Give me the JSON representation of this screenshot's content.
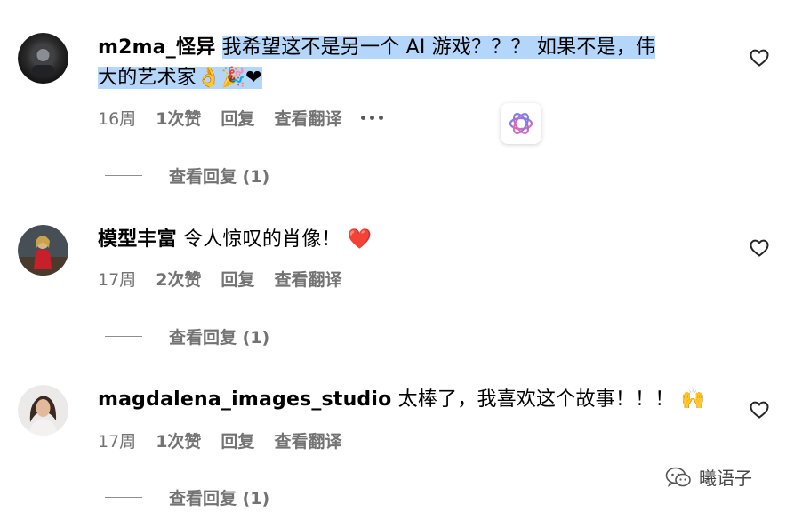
{
  "comments": [
    {
      "username": "m2ma_怪异",
      "text_line1": "我希望这不是另一个 AI 游戏？？？ 如果不是，伟",
      "text_line2": "大的艺术家👌🎉❤",
      "time": "16周",
      "likes": "1次赞",
      "reply": "回复",
      "translate": "查看翻译",
      "view_replies": "查看回复 (1)"
    },
    {
      "username": "模型丰富",
      "text_line1": "令人惊叹的肖像！ ❤️",
      "time": "17周",
      "likes": "2次赞",
      "reply": "回复",
      "translate": "查看翻译",
      "view_replies": "查看回复 (1)"
    },
    {
      "username": "magdalena_images_studio",
      "text_line1": "太棒了，我喜欢这个故事！！！ 🙌",
      "time": "17周",
      "likes": "1次赞",
      "reply": "回复",
      "translate": "查看翻译",
      "view_replies": "查看回复 (1)"
    }
  ],
  "icons": {
    "like": "heart-outline-icon",
    "more": "more-dots-icon",
    "overlay": "openai-logo-icon",
    "watermark": "wechat-icon"
  },
  "watermark": {
    "text": "曦语子"
  },
  "colors": {
    "highlight": "#b4d6fb",
    "meta": "#737373",
    "text": "#000000"
  }
}
